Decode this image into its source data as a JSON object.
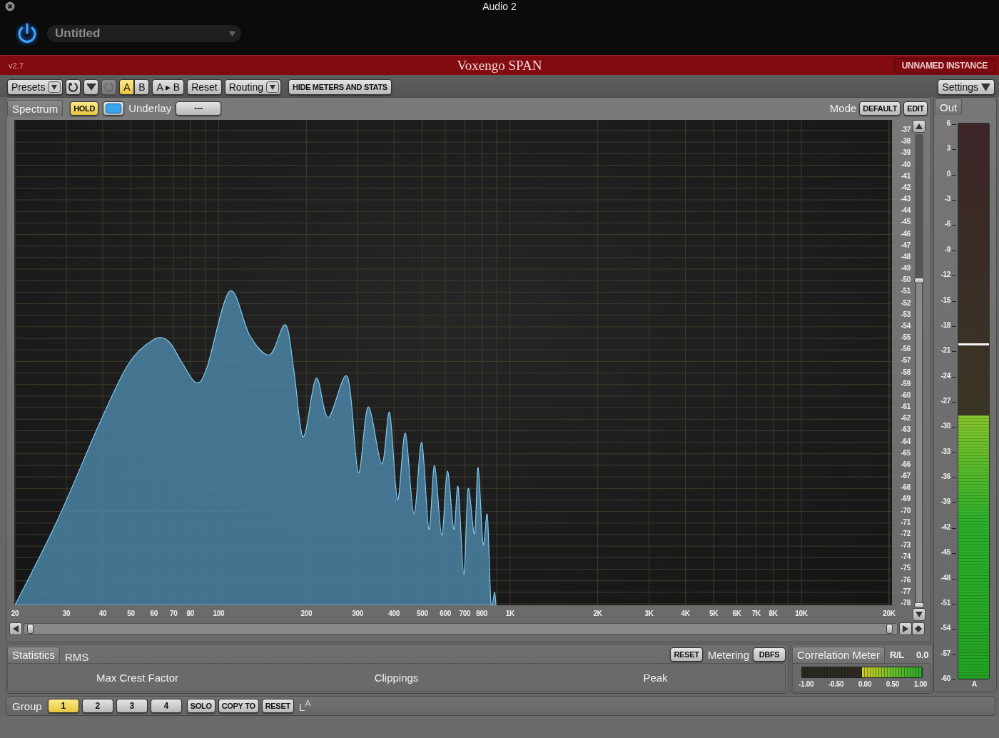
{
  "window": {
    "title": "Audio 2"
  },
  "host": {
    "power": {
      "on": true
    },
    "preset": "Untitled"
  },
  "banner": {
    "version": "v2.7",
    "title": "Voxengo SPAN",
    "instance": "UNNAMED INSTANCE"
  },
  "toolbar": {
    "presets": "Presets",
    "undo": {
      "disabled": false
    },
    "redo": {
      "disabled": true
    },
    "ab": [
      {
        "label": "A",
        "selected": true
      },
      {
        "label": "B",
        "selected": false
      }
    ],
    "copy_ab": "A ▸ B",
    "reset": "Reset",
    "routing": "Routing",
    "hide_meters": "HIDE METERS AND STATS",
    "settings": "Settings"
  },
  "spectrum": {
    "tab": "Spectrum",
    "hold": {
      "label": "HOLD",
      "on": true
    },
    "underlay_label": "Underlay",
    "underlay_value": "---",
    "mode_label": "Mode",
    "mode_buttons": [
      "DEFAULT",
      "EDIT"
    ],
    "y_labels": [
      "-37",
      "-38",
      "-39",
      "-40",
      "-41",
      "-42",
      "-43",
      "-44",
      "-45",
      "-46",
      "-47",
      "-48",
      "-49",
      "-50",
      "-51",
      "-52",
      "-53",
      "-54",
      "-55",
      "-56",
      "-57",
      "-58",
      "-59",
      "-60",
      "-61",
      "-62",
      "-63",
      "-64",
      "-65",
      "-66",
      "-67",
      "-68",
      "-69",
      "-70",
      "-71",
      "-72",
      "-73",
      "-74",
      "-75",
      "-76",
      "-77",
      "-78"
    ],
    "x_labels": [
      "20",
      "30",
      "40",
      "50",
      "60",
      "70",
      "80",
      "100",
      "200",
      "300",
      "400",
      "500",
      "600",
      "700",
      "800",
      "1K",
      "2K",
      "3K",
      "4K",
      "5K",
      "6K",
      "7K",
      "8K",
      "10K",
      "20K"
    ]
  },
  "statistics": {
    "tab": "Statistics",
    "rms": "RMS",
    "reset": "RESET",
    "metering_label": "Metering",
    "metering_value": "DBFS",
    "fields": [
      "Max Crest Factor",
      "Clippings",
      "Peak"
    ]
  },
  "correlation": {
    "tab": "Correlation Meter",
    "channel": "R/L",
    "value": "0.0",
    "level": 0.5,
    "scale": [
      "-1.00",
      "-0.50",
      "0.00",
      "0.50",
      "1.00"
    ]
  },
  "out": {
    "tab": "Out",
    "level": 0.474,
    "peak_hold": {
      "level": 0.6
    },
    "channel": "A",
    "scale": [
      "6",
      "3",
      "0",
      "-3",
      "-6",
      "-9",
      "-12",
      "-15",
      "-18",
      "-21",
      "-24",
      "-27",
      "-30",
      "-33",
      "-36",
      "-39",
      "-42",
      "-45",
      "-48",
      "-51",
      "-54",
      "-57",
      "-60"
    ]
  },
  "group": {
    "label": "Group",
    "buttons": [
      {
        "label": "1",
        "selected": true
      },
      {
        "label": "2",
        "selected": false
      },
      {
        "label": "3",
        "selected": false
      },
      {
        "label": "4",
        "selected": false
      }
    ],
    "actions": [
      "SOLO",
      "COPY TO",
      "RESET"
    ],
    "link": "L$^{A}$"
  }
}
